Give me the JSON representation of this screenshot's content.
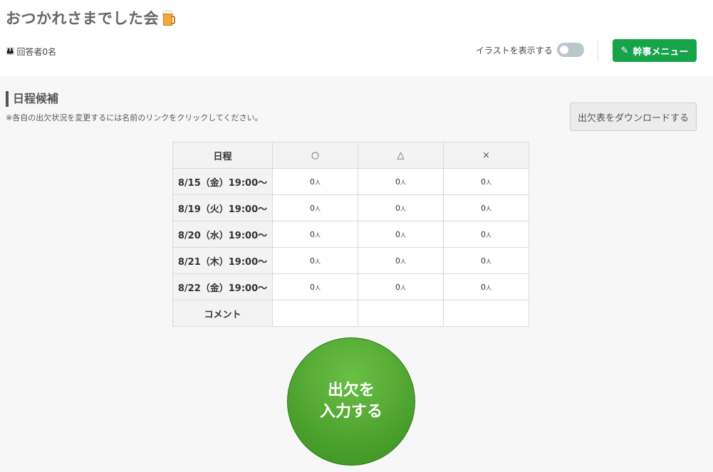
{
  "header": {
    "title": "おつかれさまでした会",
    "title_icon": "beer-mug-icon",
    "respondents_icon": "people-icon",
    "respondents_label": "回答者0名",
    "illustration_toggle_label": "イラストを表示する",
    "illustration_toggle_on": false,
    "admin_menu_label": "幹事メニュー",
    "admin_menu_icon": "pen-icon",
    "accent_color": "#16a34a"
  },
  "schedule": {
    "section_title": "日程候補",
    "note": "※各自の出欠状況を変更するには名前のリンクをクリックしてください。",
    "download_label": "出欠表をダウンロードする",
    "columns": [
      "日程",
      "○",
      "△",
      "×"
    ],
    "unit": "人",
    "rows": [
      {
        "date": "8/15（金）19:00〜",
        "counts": [
          "0",
          "0",
          "0"
        ]
      },
      {
        "date": "8/19（火）19:00〜",
        "counts": [
          "0",
          "0",
          "0"
        ]
      },
      {
        "date": "8/20（水）19:00〜",
        "counts": [
          "0",
          "0",
          "0"
        ]
      },
      {
        "date": "8/21（木）19:00〜",
        "counts": [
          "0",
          "0",
          "0"
        ]
      },
      {
        "date": "8/22（金）19:00〜",
        "counts": [
          "0",
          "0",
          "0"
        ]
      }
    ],
    "comment_label": "コメント"
  },
  "attendance_button": {
    "line1": "出欠を",
    "line2": "入力する",
    "color": "#4fa530"
  }
}
